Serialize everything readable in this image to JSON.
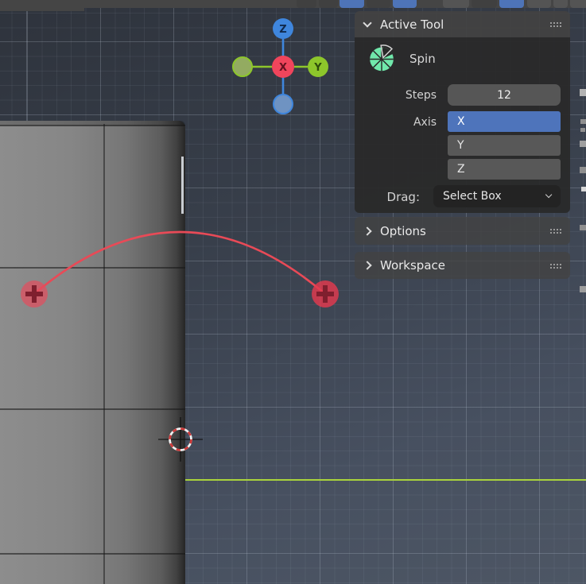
{
  "panels": {
    "active_tool": {
      "title": "Active Tool",
      "tool": {
        "name": "Spin",
        "icon": "spin-icon"
      },
      "fields": {
        "steps": {
          "label": "Steps",
          "value": "12"
        },
        "axis": {
          "label": "Axis",
          "options": [
            "X",
            "Y",
            "Z"
          ],
          "selected": "X"
        },
        "drag": {
          "label": "Drag:",
          "value": "Select Box"
        }
      }
    },
    "options": {
      "title": "Options"
    },
    "workspace": {
      "title": "Workspace"
    }
  },
  "gizmo": {
    "z_label": "Z",
    "x_label": "X",
    "y_label": "Y",
    "colors": {
      "x": "#f0455c",
      "y": "#8dc62b",
      "z": "#3f86dd"
    }
  },
  "viewport": {
    "spin_gizmo": {
      "handle_icon": "plus-icon",
      "arc_color": "#e84a57"
    },
    "cursor_icon": "3d-cursor",
    "axis_line_color": "#a9d33c",
    "accent_blue": "#4e74bb",
    "spin_icon_green": "#70e8ab"
  }
}
